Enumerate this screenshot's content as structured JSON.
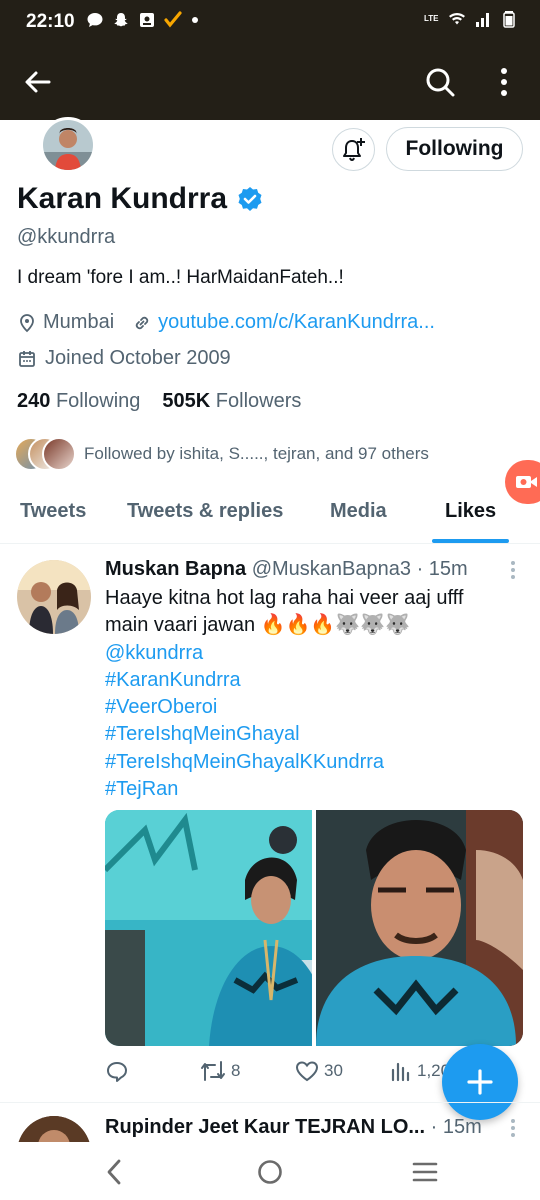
{
  "status_bar": {
    "time": "22:10",
    "network": "LTE"
  },
  "header": {
    "back_icon": "arrow-left-icon",
    "search_icon": "search-icon",
    "more_icon": "more-vertical-icon"
  },
  "profile": {
    "name": "Karan Kundrra",
    "handle": "@kkundrra",
    "bio": "I dream 'fore I am..! HarMaidanFateh..!",
    "location": "Mumbai",
    "website": "youtube.com/c/KaranKundrra...",
    "joined": "Joined October 2009",
    "following_count": "240",
    "following_label": "Following",
    "followers_count": "505K",
    "followers_label": "Followers",
    "followed_by": "Followed by ishita, S....., tejran, and 97 others",
    "follow_button": "Following",
    "verified_color": "#1d9bf0"
  },
  "tabs": [
    {
      "label": "Tweets",
      "active": false
    },
    {
      "label": "Tweets & replies",
      "active": false
    },
    {
      "label": "Media",
      "active": false
    },
    {
      "label": "Likes",
      "active": true
    }
  ],
  "tweets": [
    {
      "name": "Muskan Bapna",
      "handle": "@MuskanBapna3",
      "time": "· 15m",
      "text_line1": "Haaye kitna hot lag raha hai veer aaj ufff",
      "text_line2": "main vaari jawan 🔥🔥🔥🐺🐺🐺",
      "mention": "@kkundrra",
      "hashtags": [
        "#KaranKundrra",
        "#VeerOberoi",
        "#TereIshqMeinGhayal",
        "#TereIshqMeinGhayalKKundrra",
        "#TejRan"
      ],
      "retweets": "8",
      "likes": "30",
      "views": "1,20"
    },
    {
      "name": "Rupinder Jeet Kaur TEJRAN LO...",
      "time": "· 15m"
    }
  ],
  "colors": {
    "accent": "#1d9bf0",
    "header_bg": "#231f17",
    "record_fab": "#ff6b55"
  }
}
